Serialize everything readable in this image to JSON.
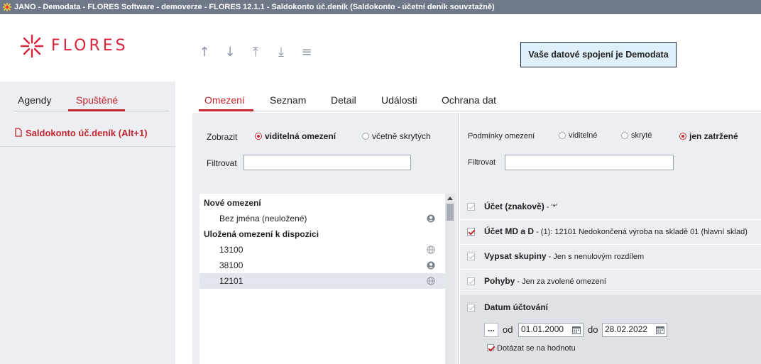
{
  "window": {
    "title": "JANO - Demodata - FLORES Software - demoverze - FLORES 12.1.1 - Saldokonto úč.deník  (Saldokonto - účetní deník souvztažně)"
  },
  "header": {
    "logo_text": "FLORES",
    "nav": [
      {
        "icon": "arrow-up-icon",
        "glyph": "↑"
      },
      {
        "icon": "arrow-down-icon",
        "glyph": "↓"
      },
      {
        "icon": "arrow-top-icon",
        "glyph": "⤒"
      },
      {
        "icon": "arrow-bottom-icon",
        "glyph": "⤓"
      },
      {
        "icon": "menu-icon",
        "glyph": "≡"
      }
    ],
    "connection": "Vaše datové spojení je Demodata"
  },
  "left": {
    "tabs": [
      "Agendy",
      "Spuštěné"
    ],
    "active_tab": "Spuštěné",
    "item": "Saldokonto úč.deník (Alt+1)"
  },
  "main": {
    "tabs": [
      "Omezení",
      "Seznam",
      "Detail",
      "Události",
      "Ochrana dat"
    ],
    "active_tab": "Omezení"
  },
  "filters": {
    "show_label": "Zobrazit",
    "opt_visible": "viditelná omezení",
    "opt_all": "včetně skrytých",
    "filter_label": "Filtrovat",
    "filter_value": "",
    "groups": [
      {
        "title": "Nové omezení",
        "items": [
          {
            "name": "Bez jména (neuložené)",
            "icon": "user-icon"
          }
        ]
      },
      {
        "title": "Uložená omezení k dispozici",
        "items": [
          {
            "name": "13100",
            "icon": "globe-icon"
          },
          {
            "name": "38100",
            "icon": "user-icon"
          },
          {
            "name": "12101",
            "icon": "globe-icon"
          }
        ]
      }
    ]
  },
  "conditions": {
    "label": "Podmínky omezení",
    "opt_visible": "viditelné",
    "opt_hidden": "skryté",
    "opt_checked": "jen zatržené",
    "filter_label": "Filtrovat",
    "filter_value": "",
    "items": [
      {
        "name": "Účet (znakově)",
        "desc": " - '*'"
      },
      {
        "name": "Účet MD a D",
        "desc": " - (1): 12101 Nedokončená výroba na skladě 01 (hlavní sklad)"
      },
      {
        "name": "Vypsat skupiny",
        "desc": " - Jen s nenulovým rozdílem"
      },
      {
        "name": "Pohyby",
        "desc": " - Jen za zvolené omezení"
      },
      {
        "name": "Datum účtování",
        "desc": ""
      }
    ],
    "date": {
      "btn": "...",
      "from_label": "od",
      "from": "01.01.2000",
      "to_label": "do",
      "to": "28.02.2022",
      "ask": "Dotázat se na hodnotu"
    }
  },
  "colors": {
    "accent": "#c3242f",
    "titlebar": "#6f7888",
    "panel": "#edeef1",
    "conn_bg": "#dff0fb"
  }
}
